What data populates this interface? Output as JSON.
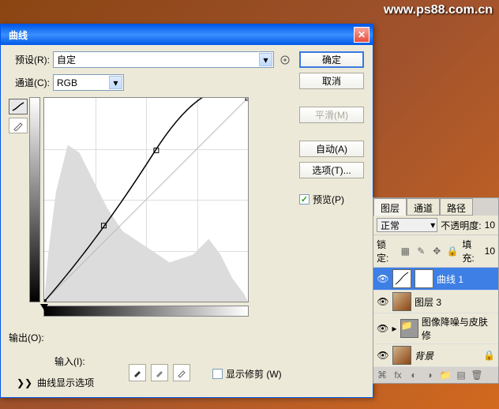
{
  "watermark": "www.ps88.com.cn",
  "dialog": {
    "title": "曲线",
    "preset_label": "预设(R):",
    "preset_value": "自定",
    "channel_label": "通道(C):",
    "channel_value": "RGB",
    "output_label": "输出(O):",
    "input_label": "输入(I):",
    "show_clipping": "显示修剪 (W)",
    "expand_label": "曲线显示选项"
  },
  "buttons": {
    "ok": "确定",
    "cancel": "取消",
    "smooth": "平滑(M)",
    "auto": "自动(A)",
    "options": "选项(T)..."
  },
  "preview": "预览(P)",
  "panels": {
    "tabs": [
      "图层",
      "通道",
      "路径"
    ],
    "blend_label": "正常",
    "opacity_label": "不透明度:",
    "opacity_value": "10",
    "lock_label": "锁定:",
    "fill_label": "填充:",
    "fill_value": "10",
    "layers": [
      {
        "name": "曲线 1",
        "type": "adjustment",
        "active": true
      },
      {
        "name": "图层 3",
        "type": "image"
      },
      {
        "name": "图像降噪与皮肤修",
        "type": "group"
      },
      {
        "name": "背景",
        "type": "image",
        "locked": true
      }
    ]
  },
  "chart_data": {
    "type": "line",
    "title": "Curves",
    "xlabel": "Input",
    "ylabel": "Output",
    "xlim": [
      0,
      255
    ],
    "ylim": [
      0,
      255
    ],
    "series": [
      {
        "name": "RGB curve",
        "points": [
          [
            0,
            0
          ],
          [
            75,
            95
          ],
          [
            140,
            190
          ],
          [
            255,
            255
          ]
        ]
      }
    ],
    "histogram_note": "grayscale histogram with peak near shadows ~20-60 and small bump ~200"
  }
}
